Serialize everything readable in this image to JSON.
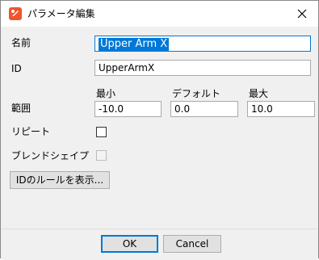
{
  "title": "パラメータ編集",
  "fields": {
    "name_label": "名前",
    "name_value": "Upper Arm X",
    "id_label": "ID",
    "id_value": "UpperArmX",
    "range_label": "範囲",
    "min_label": "最小",
    "min_value": "-10.0",
    "default_label": "デフォルト",
    "default_value": "0.0",
    "max_label": "最大",
    "max_value": "10.0",
    "repeat_label": "リピート",
    "repeat_checked": false,
    "blendshape_label": "ブレンドシェイプ",
    "blendshape_checked": false,
    "blendshape_enabled": false
  },
  "buttons": {
    "id_rules": "IDのルールを表示...",
    "ok": "OK",
    "cancel": "Cancel"
  },
  "colors": {
    "accent": "#0078d7",
    "app_icon": "#f0552b"
  },
  "icons": {
    "app": "app-logo-icon",
    "close": "close-icon"
  }
}
